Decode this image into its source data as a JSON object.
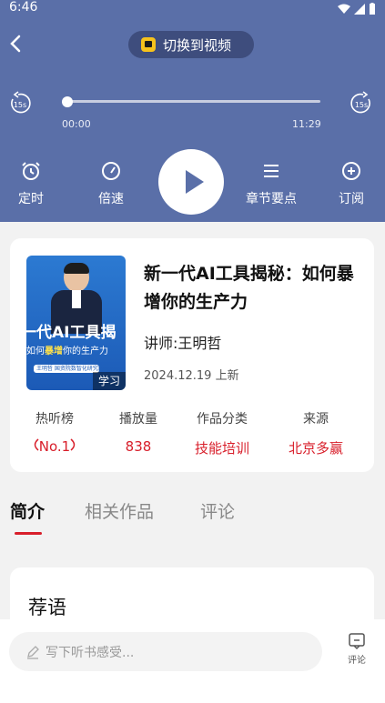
{
  "status": {
    "time": "6:46"
  },
  "header": {
    "switch_label": "切换到视频",
    "skip_back_label": "15s",
    "skip_forward_label": "15s",
    "time_current": "00:00",
    "time_total": "11:29",
    "progress": 0
  },
  "controls": {
    "timer": "定时",
    "speed": "倍速",
    "chapters": "章节要点",
    "subscribe": "订阅"
  },
  "book": {
    "title": "新一代AI工具揭秘：如何暴增你的生产力",
    "lecturer": "讲师:王明哲",
    "date": "2024.12.19 上新",
    "cover": {
      "big_text": "一代AI工具揭",
      "sub_prefix": "如何",
      "sub_highlight": "暴增",
      "sub_suffix": "你的生产力",
      "tag": "王明哲 国资院数智化研究院",
      "learn": "学习"
    }
  },
  "stats": [
    {
      "label": "热听榜",
      "value": "No.1"
    },
    {
      "label": "播放量",
      "value": "838"
    },
    {
      "label": "作品分类",
      "value": "技能培训"
    },
    {
      "label": "来源",
      "value": "北京多赢"
    }
  ],
  "tabs": [
    "简介",
    "相关作品",
    "评论"
  ],
  "recommend": {
    "title": "荐语"
  },
  "bottom": {
    "input_placeholder": "写下听书感受...",
    "comment_label": "评论"
  },
  "colors": {
    "header": "#5a6fa8",
    "accent": "#d81e2a"
  }
}
